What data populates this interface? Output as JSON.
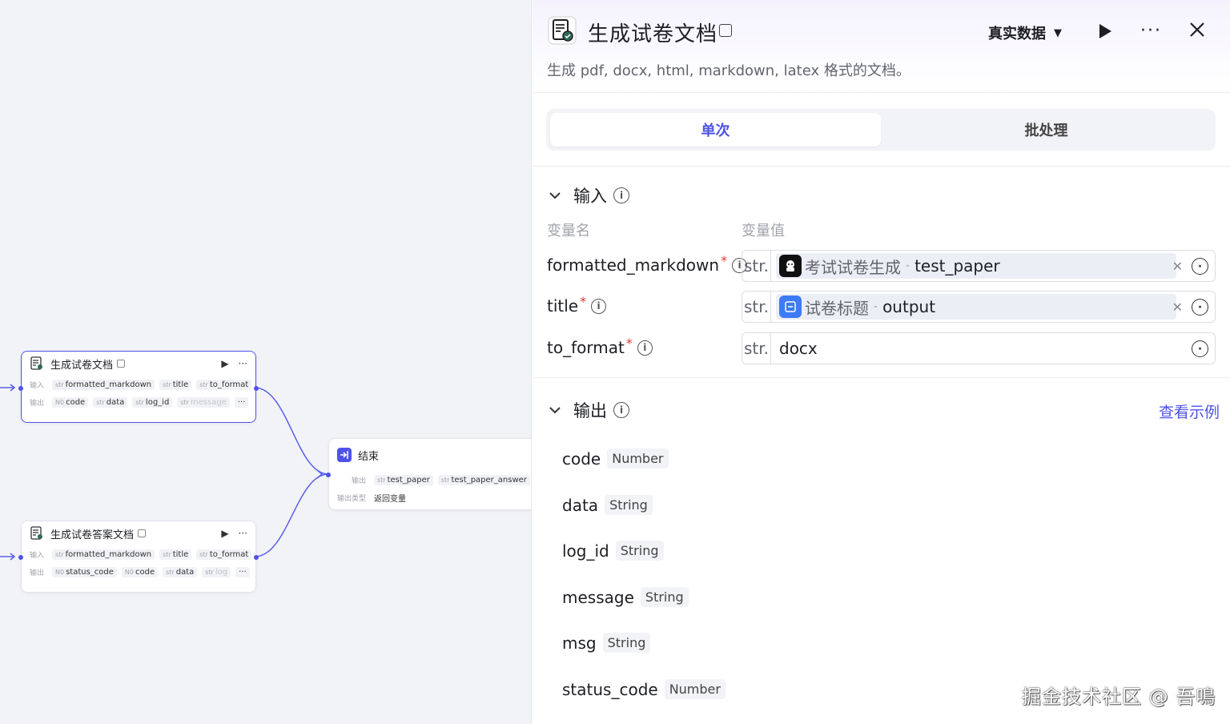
{
  "canvas": {
    "node1": {
      "title": "生成试卷文档",
      "input_label": "输入",
      "inputs": [
        {
          "type": "str",
          "name": "formatted_markdown"
        },
        {
          "type": "str",
          "name": "title"
        },
        {
          "type": "str",
          "name": "to_format"
        }
      ],
      "output_label": "输出",
      "outputs": [
        {
          "type": "N0",
          "name": "code"
        },
        {
          "type": "str",
          "name": "data"
        },
        {
          "type": "str",
          "name": "log_id"
        },
        {
          "type": "str",
          "name": "message"
        }
      ],
      "more": "···"
    },
    "node2": {
      "title": "结束",
      "output_label": "输出",
      "outputs": [
        {
          "type": "str",
          "name": "test_paper"
        },
        {
          "type": "str",
          "name": "test_paper_answer"
        }
      ],
      "output_type_label": "输出类型",
      "output_type_value": "返回变量"
    },
    "node3": {
      "title": "生成试卷答案文档",
      "input_label": "输入",
      "inputs": [
        {
          "type": "str",
          "name": "formatted_markdown"
        },
        {
          "type": "str",
          "name": "title"
        },
        {
          "type": "str",
          "name": "to_format"
        }
      ],
      "output_label": "输出",
      "outputs": [
        {
          "type": "N0",
          "name": "status_code"
        },
        {
          "type": "N0",
          "name": "code"
        },
        {
          "type": "str",
          "name": "data"
        },
        {
          "type": "str",
          "name": "log"
        }
      ],
      "more": "···"
    },
    "accent_color": "#4d53e8"
  },
  "panel": {
    "title": "生成试卷文档",
    "data_mode": "真实数据",
    "more": "···",
    "description": "生成 pdf, docx, html, markdown, latex 格式的文档。",
    "tabs": [
      "单次",
      "批处理"
    ],
    "input": {
      "title": "输入",
      "col_name": "变量名",
      "col_value": "变量值",
      "rows": [
        {
          "name": "formatted_markdown",
          "required": "*",
          "type": "str.",
          "source": "考试试卷生成",
          "sep": "-",
          "var": "test_paper",
          "value": ""
        },
        {
          "name": "title",
          "required": "*",
          "type": "str.",
          "source": "试卷标题",
          "sep": "-",
          "var": "output",
          "value": ""
        },
        {
          "name": "to_format",
          "required": "*",
          "type": "str.",
          "source": "",
          "sep": "",
          "var": "",
          "value": "docx"
        }
      ]
    },
    "output": {
      "title": "输出",
      "see_example": "查看示例",
      "rows": [
        {
          "name": "code",
          "type": "Number"
        },
        {
          "name": "data",
          "type": "String"
        },
        {
          "name": "log_id",
          "type": "String"
        },
        {
          "name": "message",
          "type": "String"
        },
        {
          "name": "msg",
          "type": "String"
        },
        {
          "name": "status_code",
          "type": "Number"
        }
      ]
    }
  },
  "watermark": "掘金技术社区 @ 吾鳴"
}
